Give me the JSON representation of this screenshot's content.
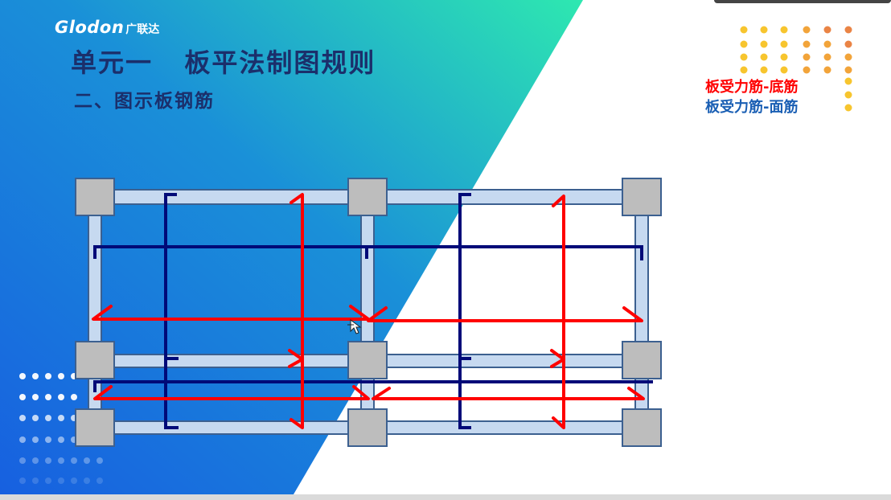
{
  "brand": {
    "name": "Glodon",
    "name_cn": "广联达"
  },
  "title": "单元一   板平法制图规则",
  "subtitle": "二、图示板钢筋",
  "legend": {
    "bottom_rebar": "板受力筋-底筋",
    "top_rebar": "板受力筋-面筋"
  },
  "colors": {
    "bottom_rebar": "#ff0000",
    "top_rebar": "#000a78",
    "beam_fill": "#c6d9f0",
    "beam_stroke": "#3c6090",
    "column_fill": "#bdbdbd",
    "title": "#1b2f6b",
    "gradient_start": "#1f6fe0",
    "gradient_end": "#2fe0b0"
  },
  "icons": {
    "cursor": "move-cursor-icon"
  }
}
